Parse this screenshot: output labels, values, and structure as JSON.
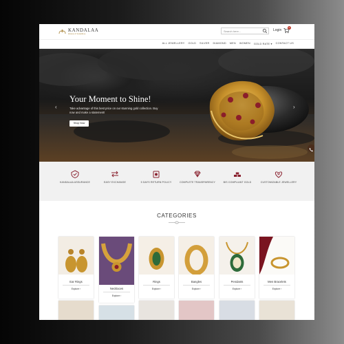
{
  "header": {
    "brand_name": "KANDALAA",
    "brand_tagline": "House of Jewellery",
    "search_placeholder": "Search here...",
    "login_label": "Login",
    "cart_count": "0"
  },
  "nav": {
    "items": [
      "ALL JEWELLERY",
      "GOLD",
      "SILVER",
      "DIAMOND",
      "MEN",
      "WOMEN",
      "GOLD RATE ▾",
      "CONTACT US"
    ]
  },
  "hero": {
    "title": "Your Moment to Shine!",
    "subtitle": "Take advantage of this best price on our stunning gold collection. Buy now and make a statement!",
    "button": "Shop Now",
    "prev": "‹",
    "next": "›"
  },
  "features": [
    {
      "label": "KANDALAA ASSURANCE",
      "icon": "assurance-icon"
    },
    {
      "label": "EASY EXCHANGE",
      "icon": "exchange-icon"
    },
    {
      "label": "5 DAYS RETURN POLICY",
      "icon": "return-icon"
    },
    {
      "label": "COMPLETE TRANSPARENCY",
      "icon": "diamond-icon"
    },
    {
      "label": "BIS COMPLIANT GOLD",
      "icon": "gold-bars-icon"
    },
    {
      "label": "CUSTOMIZABLE JEWELLERY",
      "icon": "customize-icon"
    }
  ],
  "categories": {
    "title": "CATEGORIES",
    "explore_label": "Explore",
    "items": [
      {
        "name": "Ear Rings"
      },
      {
        "name": "Necklaces"
      },
      {
        "name": "Rings"
      },
      {
        "name": "Bangles"
      },
      {
        "name": "Pendants"
      },
      {
        "name": "Men Bracelets"
      }
    ]
  },
  "colors": {
    "accent_gold": "#a27a28",
    "feature_icon": "#8a2230",
    "hero_dark": "#1e1e1e"
  }
}
